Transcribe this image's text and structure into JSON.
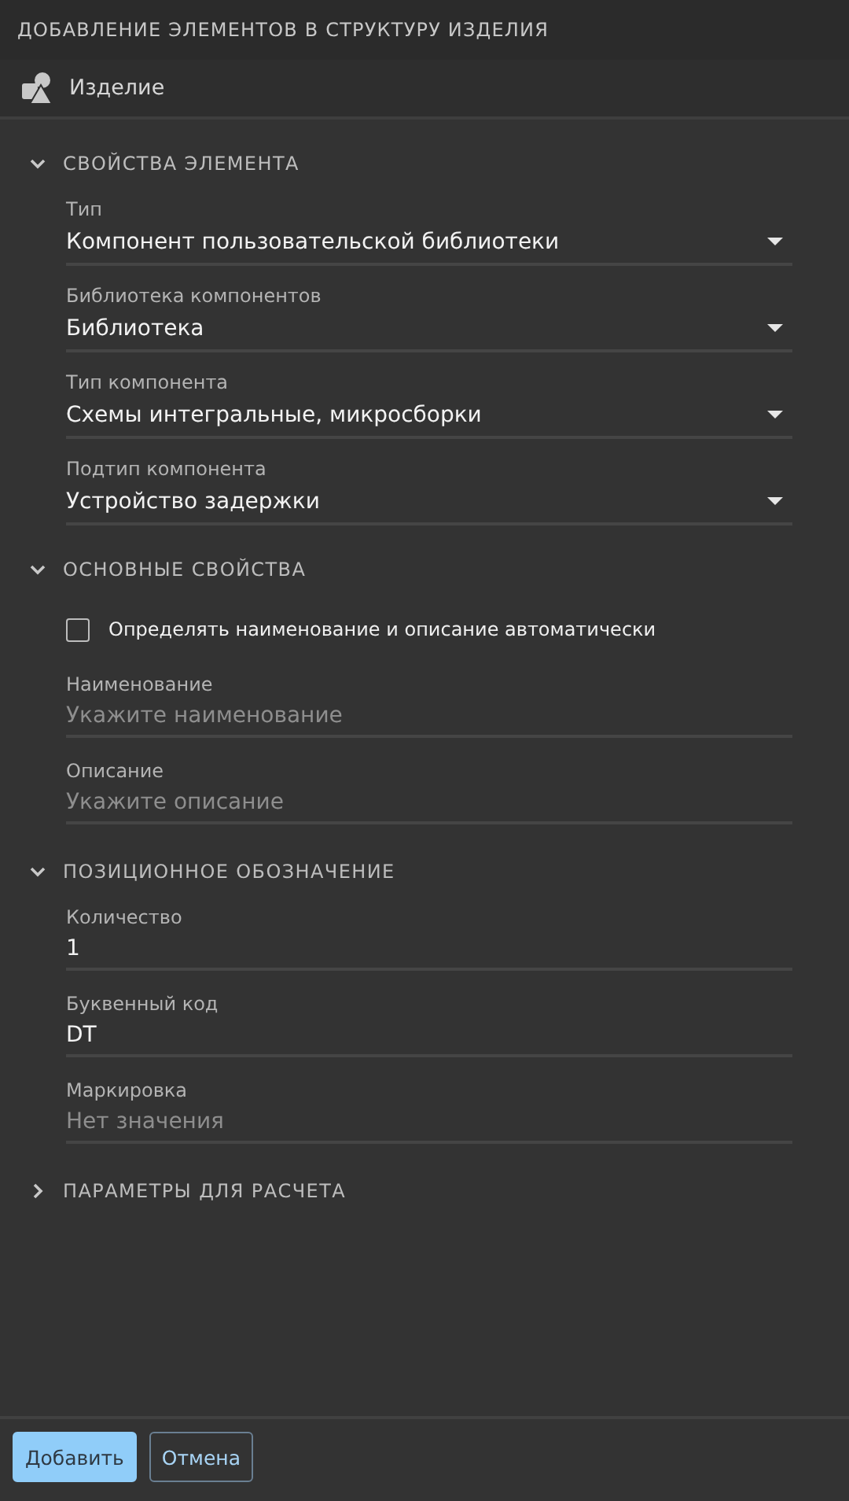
{
  "window": {
    "title": "ДОБАВЛЕНИЕ ЭЛЕМЕНТОВ В СТРУКТУРУ ИЗДЕЛИЯ"
  },
  "product": {
    "label": "Изделие"
  },
  "sections": [
    {
      "title": "СВОЙСТВА ЭЛЕМЕНТА",
      "expanded": true,
      "fields": [
        {
          "kind": "select",
          "label": "Тип",
          "value": "Компонент пользовательской библиотеки"
        },
        {
          "kind": "select",
          "label": "Библиотека компонентов",
          "value": "Библиотека"
        },
        {
          "kind": "select",
          "label": "Тип компонента",
          "value": "Схемы интегральные, микросборки"
        },
        {
          "kind": "select",
          "label": "Подтип компонента",
          "value": "Устройство задержки"
        }
      ]
    },
    {
      "title": "ОСНОВНЫЕ СВОЙСТВА",
      "expanded": true,
      "fields": [
        {
          "kind": "checkbox",
          "label": "Определять наименование и описание автоматически",
          "checked": false
        },
        {
          "kind": "text",
          "label": "Наименование",
          "placeholder": "Укажите наименование"
        },
        {
          "kind": "text",
          "label": "Описание",
          "placeholder": "Укажите описание"
        }
      ]
    },
    {
      "title": "ПОЗИЦИОННОЕ ОБОЗНАЧЕНИЕ",
      "expanded": true,
      "fields": [
        {
          "kind": "text",
          "label": "Количество",
          "value": "1"
        },
        {
          "kind": "text",
          "label": "Буквенный код",
          "value": "DT"
        },
        {
          "kind": "text",
          "label": "Маркировка",
          "placeholder": "Нет значения"
        }
      ]
    },
    {
      "title": "ПАРАМЕТРЫ ДЛЯ РАСЧЕТА",
      "expanded": false
    }
  ],
  "buttons": [
    {
      "label": "Добавить",
      "kind": "primary"
    },
    {
      "label": "Отмена",
      "kind": "secondary"
    }
  ]
}
